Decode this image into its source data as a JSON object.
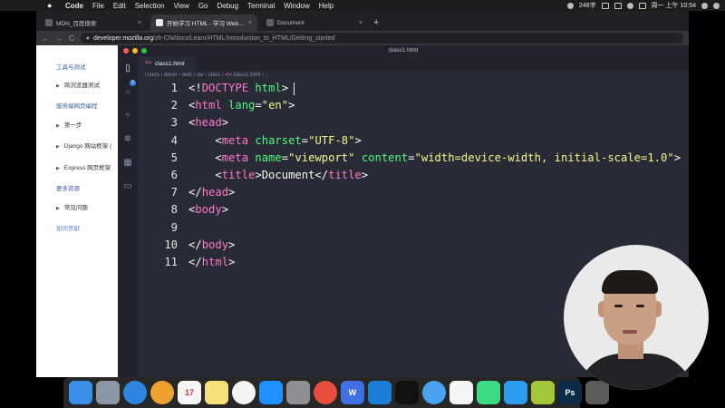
{
  "menubar": {
    "app": "Code",
    "items": [
      "File",
      "Edit",
      "Selection",
      "View",
      "Go",
      "Debug",
      "Terminal",
      "Window",
      "Help"
    ],
    "net_speed": "248字",
    "datetime": "周一 上午 10:54"
  },
  "browser": {
    "tabs": [
      {
        "label": "MDN_百度搜索",
        "close": "×"
      },
      {
        "label": "开始学习 HTML - 学习 Web 开发",
        "close": "×"
      },
      {
        "label": "Document",
        "close": "×"
      }
    ],
    "new_tab": "+",
    "nav": {
      "back": "←",
      "forward": "→",
      "reload": "C"
    },
    "url": {
      "host": "developer.mozilla.org",
      "path": "/zh-CN/docs/Learn/HTML/Introduction_to_HTML/Getting_started"
    }
  },
  "mdn_sidebar": {
    "section1": "工具与测试",
    "item1": "跨浏览器测试",
    "section2": "服务端网页编程",
    "item2": "第一步",
    "item3": "Django 网站框架 (",
    "item4": "Express 网页框架",
    "section3": "更多资源",
    "item5": "常见问题",
    "contribute": "如何贡献"
  },
  "vscode": {
    "window_title": "class1.html",
    "tab_label": "class1.html",
    "tab_icon": "<>",
    "breadcrumb": [
      "Users",
      "dixon",
      "web",
      "sw",
      "class",
      "class1.html",
      "..."
    ],
    "explorer_badge": "1",
    "activity_icons": [
      "files-icon",
      "search-icon",
      "source-control-icon",
      "debug-icon",
      "extensions-icon",
      "remote-icon"
    ],
    "code_lines": [
      {
        "n": "1",
        "tokens": [
          [
            "p",
            "<!"
          ],
          [
            "t",
            "DOCTYPE"
          ],
          [
            "p",
            " "
          ],
          [
            "a",
            "html"
          ],
          [
            "p",
            ">"
          ]
        ]
      },
      {
        "n": "2",
        "tokens": [
          [
            "p",
            "<"
          ],
          [
            "t",
            "html"
          ],
          [
            "p",
            " "
          ],
          [
            "a",
            "lang"
          ],
          [
            "p",
            "="
          ],
          [
            "s",
            "\"en\""
          ],
          [
            "p",
            ">"
          ]
        ]
      },
      {
        "n": "3",
        "tokens": [
          [
            "p",
            "<"
          ],
          [
            "t",
            "head"
          ],
          [
            "p",
            ">"
          ]
        ]
      },
      {
        "n": "4",
        "tokens": [
          [
            "p",
            "    <"
          ],
          [
            "t",
            "meta"
          ],
          [
            "p",
            " "
          ],
          [
            "a",
            "charset"
          ],
          [
            "p",
            "="
          ],
          [
            "s",
            "\"UTF-8\""
          ],
          [
            "p",
            ">"
          ]
        ]
      },
      {
        "n": "5",
        "tokens": [
          [
            "p",
            "    <"
          ],
          [
            "t",
            "meta"
          ],
          [
            "p",
            " "
          ],
          [
            "a",
            "name"
          ],
          [
            "p",
            "="
          ],
          [
            "s",
            "\"viewport\""
          ],
          [
            "p",
            " "
          ],
          [
            "a",
            "content"
          ],
          [
            "p",
            "="
          ],
          [
            "s",
            "\"width=device-width, initial-scale=1.0\""
          ],
          [
            "p",
            ">"
          ]
        ]
      },
      {
        "n": "6",
        "tokens": [
          [
            "p",
            "    <"
          ],
          [
            "t",
            "title"
          ],
          [
            "p",
            ">"
          ],
          [
            "x",
            "Document"
          ],
          [
            "p",
            "</"
          ],
          [
            "t",
            "title"
          ],
          [
            "p",
            ">"
          ]
        ]
      },
      {
        "n": "7",
        "tokens": [
          [
            "p",
            "</"
          ],
          [
            "t",
            "head"
          ],
          [
            "p",
            ">"
          ]
        ]
      },
      {
        "n": "8",
        "tokens": [
          [
            "p",
            "<"
          ],
          [
            "t",
            "body"
          ],
          [
            "p",
            ">"
          ]
        ]
      },
      {
        "n": "9",
        "tokens": []
      },
      {
        "n": "10",
        "tokens": [
          [
            "p",
            "</"
          ],
          [
            "t",
            "body"
          ],
          [
            "p",
            ">"
          ]
        ]
      },
      {
        "n": "11",
        "tokens": [
          [
            "p",
            "</"
          ],
          [
            "t",
            "html"
          ],
          [
            "p",
            ">"
          ]
        ]
      }
    ]
  },
  "dock": {
    "apps": [
      {
        "name": "finder-icon",
        "color": "#3b8fe8"
      },
      {
        "name": "launchpad-icon",
        "color": "#8d96a3"
      },
      {
        "name": "safari-icon",
        "color": "#2f86e0"
      },
      {
        "name": "photos-icon",
        "color": "#f0a030"
      },
      {
        "name": "calendar-icon",
        "color": "#f5f5f5",
        "text": "17"
      },
      {
        "name": "notes-icon",
        "color": "#f7e27a"
      },
      {
        "name": "music-icon",
        "color": "#f5f5f5"
      },
      {
        "name": "app-store-icon",
        "color": "#1e90ff"
      },
      {
        "name": "system-preferences-icon",
        "color": "#8e8e93"
      },
      {
        "name": "chrome-icon",
        "color": "#e84c3d"
      },
      {
        "name": "wps-icon",
        "color": "#3f6fe0",
        "text": "W"
      },
      {
        "name": "vscode-icon",
        "color": "#1a7fd4"
      },
      {
        "name": "terminal-icon",
        "color": "#111111"
      },
      {
        "name": "qq-icon",
        "color": "#4aa3f0"
      },
      {
        "name": "photos-sync-icon",
        "color": "#f5f5f5"
      },
      {
        "name": "android-studio-icon",
        "color": "#3ddc84"
      },
      {
        "name": "paper-plane-icon",
        "color": "#2d9cf0"
      },
      {
        "name": "android-icon",
        "color": "#a4c639"
      },
      {
        "name": "photoshop-icon",
        "color": "#0b2a45",
        "text": "Ps"
      },
      {
        "name": "final-cut-icon",
        "color": "#5b5b5b"
      }
    ]
  }
}
